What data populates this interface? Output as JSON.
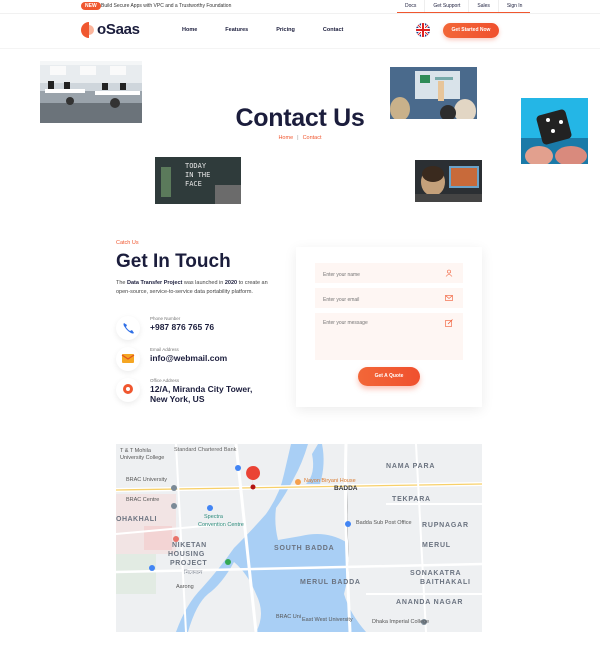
{
  "topbar": {
    "badge": "NEW",
    "announcement": "Build Secure Apps with VPC and a Trustworthy Foundation",
    "links": [
      "Docs",
      "Get Support",
      "Sales",
      "Sign In"
    ]
  },
  "header": {
    "logo": "oSaas",
    "nav": [
      "Home",
      "Features",
      "Pricing",
      "Contact"
    ],
    "cta": "Get Started Now"
  },
  "hero": {
    "title": "Contact Us",
    "breadcrumb_home": "Home",
    "breadcrumb_sep": "|",
    "breadcrumb_current": "Contact",
    "photo_sign_text": "TODAY\nIN THE\nFACE"
  },
  "contact": {
    "eyebrow": "Catch Us",
    "title": "Get In Touch",
    "intro_pre": "The ",
    "intro_strong1": "Data Transfer Project",
    "intro_mid": " was launched in ",
    "intro_strong2": "2020",
    "intro_post": " to create an open-source, service-to-service data portability platform.",
    "phone_label": "Phone Number",
    "phone_value": "+987 876 765 76",
    "email_label": "Email Address",
    "email_value": "info@webmail.com",
    "office_label": "Office Address",
    "office_value": "12/A, Miranda City Tower, New York, US"
  },
  "form": {
    "name_placeholder": "Enter your name",
    "email_placeholder": "Enter your email",
    "message_placeholder": "Enter your message",
    "submit": "Get A Quote"
  },
  "map": {
    "labels": {
      "t_mohila": "T & T Mohila",
      "university_college": "University College",
      "standard_chartered": "Standard Chartered Bank",
      "brac_university": "BRAC University",
      "brac_centre": "BRAC Centre",
      "mohakhali": "OHAKHALI",
      "spectra": "Spectra",
      "convention": "Convention Centre",
      "niketan": "NIKETAN",
      "housing": "HOUSING",
      "project": "PROJECT",
      "niketan_bn": "নিকেতন",
      "aarong": "Aarong",
      "nayon": "Nayon Biryani House",
      "badda": "BADDA",
      "nama_para": "NAMA PARA",
      "tekpara": "TEKPARA",
      "badda_post": "Badda Sub Post Office",
      "rupnagar": "RUPNAGAR",
      "merul": "MERUL",
      "south_badda": "SOUTH BADDA",
      "merul_badda": "MERUL BADDA",
      "sonakatra": "SONAKATRA",
      "baithakali": "BAITHAKALI",
      "ananda_nagar": "ANANDA NAGAR",
      "brac_uni_bottom": "BRAC Uni",
      "east_west": "East West University",
      "dhaka_imperial": "Dhaka Imperial College"
    }
  },
  "colors": {
    "accent": "#f0572f",
    "navy": "#1b1d3c",
    "field_bg": "#fef6f3",
    "map_water": "#a9cff5",
    "map_land": "#eef0f2"
  }
}
